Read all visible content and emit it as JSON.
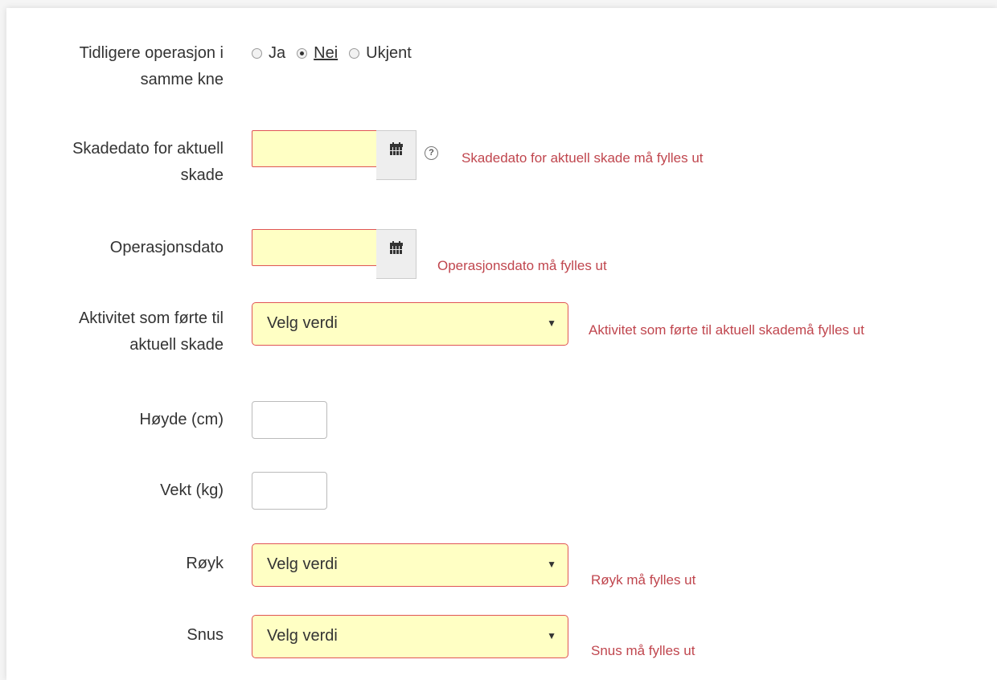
{
  "form": {
    "previous_surgery": {
      "label_line1": "Tidligere operasjon i",
      "label_line2": "samme kne",
      "options": [
        "Ja",
        "Nei",
        "Ukjent"
      ],
      "selected": "Nei"
    },
    "injury_date": {
      "label_line1": "Skadedato for aktuell",
      "label_line2": "skade",
      "value": "",
      "error": "Skadedato for aktuell skade må fylles ut",
      "help_symbol": "?"
    },
    "operation_date": {
      "label": "Operasjonsdato",
      "value": "",
      "error": "Operasjonsdato må fylles ut"
    },
    "activity": {
      "label_line1": "Aktivitet som førte til",
      "label_line2": "aktuell skade",
      "selected": "Velg verdi",
      "error": "Aktivitet som førte til aktuell skademå fylles ut"
    },
    "height": {
      "label": "Høyde (cm)",
      "value": ""
    },
    "weight": {
      "label": "Vekt (kg)",
      "value": ""
    },
    "smoking": {
      "label": "Røyk",
      "selected": "Velg verdi",
      "error": "Røyk må fylles ut"
    },
    "snus": {
      "label": "Snus",
      "selected": "Velg verdi",
      "error": "Snus må fylles ut"
    }
  },
  "colors": {
    "error_text": "#c0464e",
    "invalid_border": "#e05555",
    "invalid_background": "#ffffc4"
  },
  "icons": {
    "calendar": "calendar-icon",
    "help": "help-icon",
    "dropdown": "caret-down-icon"
  }
}
